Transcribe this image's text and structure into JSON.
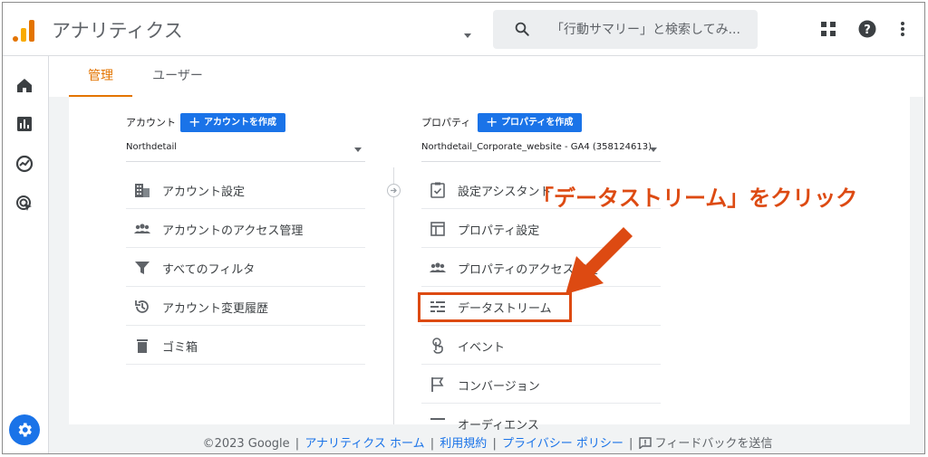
{
  "header": {
    "app_title": "アナリティクス",
    "search_placeholder": "「行動サマリー」と検索してみ..."
  },
  "tabs": [
    {
      "label": "管理"
    },
    {
      "label": "ユーザー"
    }
  ],
  "account": {
    "heading": "アカウント",
    "create_label": "アカウントを作成",
    "selected": "Northdetail",
    "items": [
      {
        "label": "アカウント設定",
        "icon": "building-icon"
      },
      {
        "label": "アカウントのアクセス管理",
        "icon": "people-icon"
      },
      {
        "label": "すべてのフィルタ",
        "icon": "filter-icon"
      },
      {
        "label": "アカウント変更履歴",
        "icon": "history-icon"
      },
      {
        "label": "ゴミ箱",
        "icon": "trash-icon"
      }
    ]
  },
  "property": {
    "heading": "プロパティ",
    "create_label": "プロパティを作成",
    "selected": "Northdetail_Corporate_website - GA4 (358124613)",
    "items": [
      {
        "label": "設定アシスタント",
        "icon": "checklist-icon"
      },
      {
        "label": "プロパティ設定",
        "icon": "layout-icon"
      },
      {
        "label": "プロパティのアクセス管理",
        "icon": "people-icon"
      },
      {
        "label": "データストリーム",
        "icon": "stream-icon"
      },
      {
        "label": "イベント",
        "icon": "touch-icon"
      },
      {
        "label": "コンバージョン",
        "icon": "flag-icon"
      },
      {
        "label": "オーディエンス",
        "icon": "audience-icon"
      }
    ]
  },
  "annotation": {
    "text": "「データストリーム」をクリック",
    "color": "#dd4a12"
  },
  "footer": {
    "copyright": "©2023 Google",
    "link_home": "アナリティクス ホーム",
    "link_terms": "利用規約",
    "link_privacy": "プライバシー ポリシー",
    "feedback": "フィードバックを送信"
  },
  "colors": {
    "accent": "#e37400",
    "primary": "#1a73e8"
  }
}
